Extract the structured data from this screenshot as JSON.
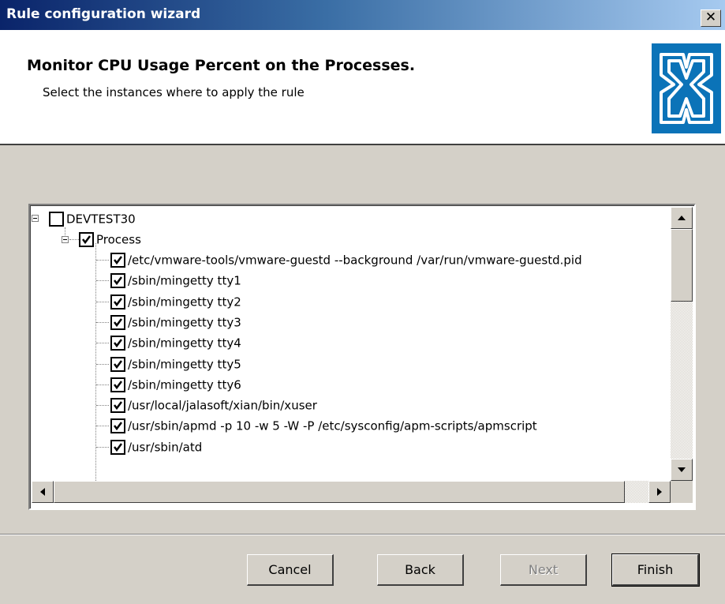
{
  "window": {
    "title": "Rule configuration wizard",
    "close_glyph": "✕"
  },
  "header": {
    "title": "Monitor CPU Usage Percent on the Processes.",
    "subtitle": "Select the instances where to apply the rule",
    "logo_icon": "brand-logo-icon",
    "logo_color": "#0b73b8"
  },
  "tree": {
    "root": {
      "label": "DEVTEST30",
      "checked": false
    },
    "group": {
      "label": "Process",
      "checked": true
    },
    "items": [
      {
        "label": "/etc/vmware-tools/vmware-guestd --background /var/run/vmware-guestd.pid",
        "checked": true
      },
      {
        "label": "/sbin/mingetty tty1",
        "checked": true
      },
      {
        "label": "/sbin/mingetty tty2",
        "checked": true
      },
      {
        "label": "/sbin/mingetty tty3",
        "checked": true
      },
      {
        "label": "/sbin/mingetty tty4",
        "checked": true
      },
      {
        "label": "/sbin/mingetty tty5",
        "checked": true
      },
      {
        "label": "/sbin/mingetty tty6",
        "checked": true
      },
      {
        "label": "/usr/local/jalasoft/xian/bin/xuser",
        "checked": true
      },
      {
        "label": "/usr/sbin/apmd -p 10 -w 5 -W -P /etc/sysconfig/apm-scripts/apmscript",
        "checked": true
      },
      {
        "label": "/usr/sbin/atd",
        "checked": true
      }
    ]
  },
  "buttons": {
    "cancel": "Cancel",
    "back": "Back",
    "next": "Next",
    "finish": "Finish"
  }
}
